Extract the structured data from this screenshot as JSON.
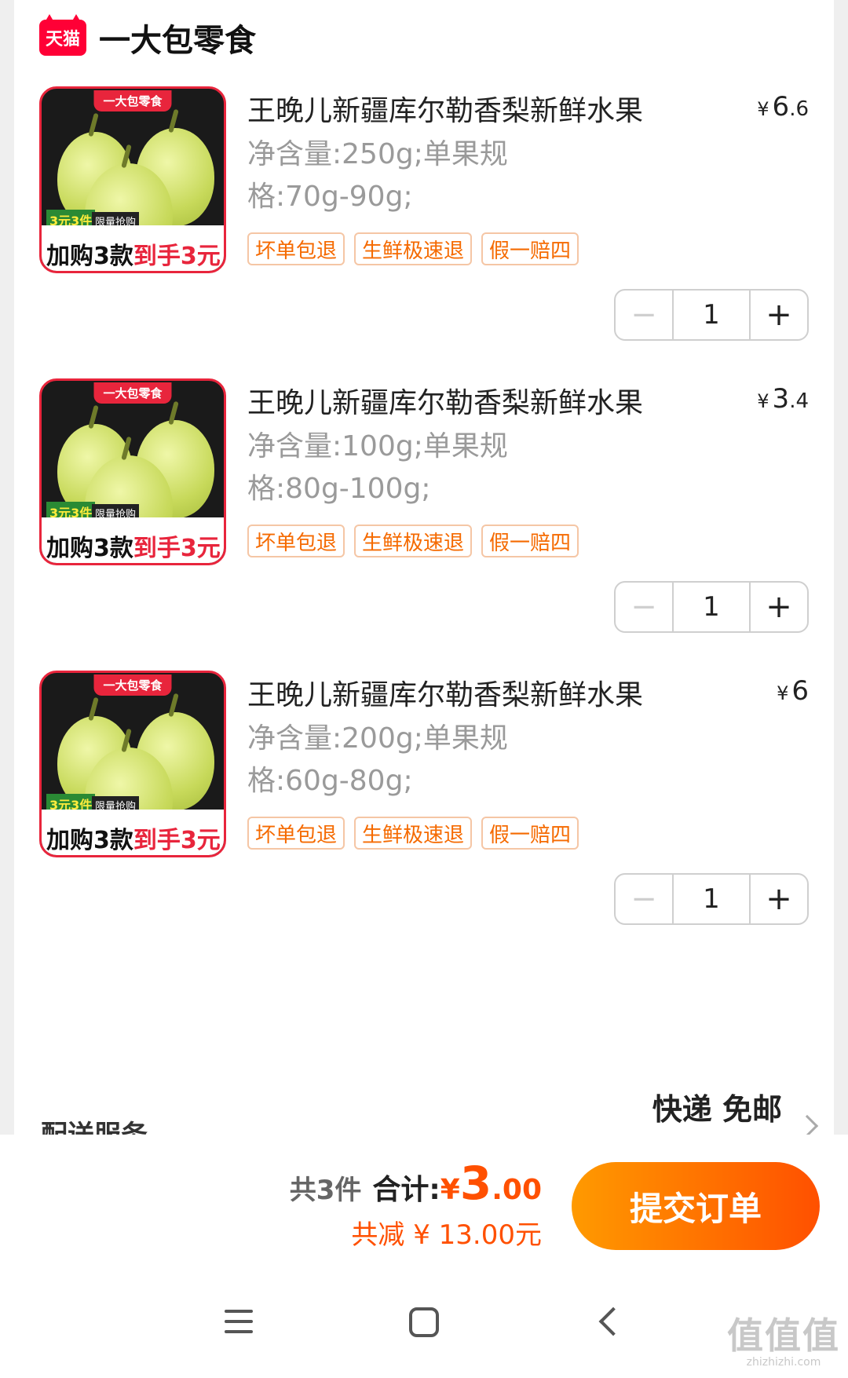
{
  "shop": {
    "logo_text": "天猫",
    "name": "一大包零食"
  },
  "items": [
    {
      "title": "王晚儿新疆库尔勒香梨新鲜水果",
      "price_symbol": "¥",
      "price_int": "6",
      "price_dec": ".6",
      "spec": "净含量:250g;单果规格:70g-90g;",
      "tags": [
        "坏单包退",
        "生鲜极速退",
        "假一赔四"
      ],
      "qty": "1",
      "thumb": {
        "brand": "一大包零食",
        "tag": "3元3件",
        "tag2": "限量抢购",
        "caption_a": "加购3款",
        "caption_b": "到手3元"
      }
    },
    {
      "title": "王晚儿新疆库尔勒香梨新鲜水果",
      "price_symbol": "¥",
      "price_int": "3",
      "price_dec": ".4",
      "spec": "净含量:100g;单果规格:80g-100g;",
      "tags": [
        "坏单包退",
        "生鲜极速退",
        "假一赔四"
      ],
      "qty": "1",
      "thumb": {
        "brand": "一大包零食",
        "tag": "3元3件",
        "tag2": "限量抢购",
        "caption_a": "加购3款",
        "caption_b": "到手3元"
      }
    },
    {
      "title": "王晚儿新疆库尔勒香梨新鲜水果",
      "price_symbol": "¥",
      "price_int": "6",
      "price_dec": "",
      "spec": "净含量:200g;单果规格:60g-80g;",
      "tags": [
        "坏单包退",
        "生鲜极速退",
        "假一赔四"
      ],
      "qty": "1",
      "thumb": {
        "brand": "一大包零食",
        "tag": "3元3件",
        "tag2": "限量抢购",
        "caption_a": "加购3款",
        "caption_b": "到手3元"
      }
    }
  ],
  "stepper": {
    "minus": "−",
    "plus": "+"
  },
  "delivery": {
    "label": "配送服务",
    "value": "快递 免邮"
  },
  "summary": {
    "count": "共3件",
    "total_label": "合计:",
    "total_symbol": "¥",
    "total_int": "3",
    "total_dec": ".00",
    "saved": "共减 ¥ 13.00元"
  },
  "submit_label": "提交订单",
  "nav": {
    "icons": [
      "menu-icon",
      "home-icon",
      "back-icon"
    ]
  },
  "watermark": {
    "big": "值值值",
    "small": "zhizhizhi.com"
  }
}
